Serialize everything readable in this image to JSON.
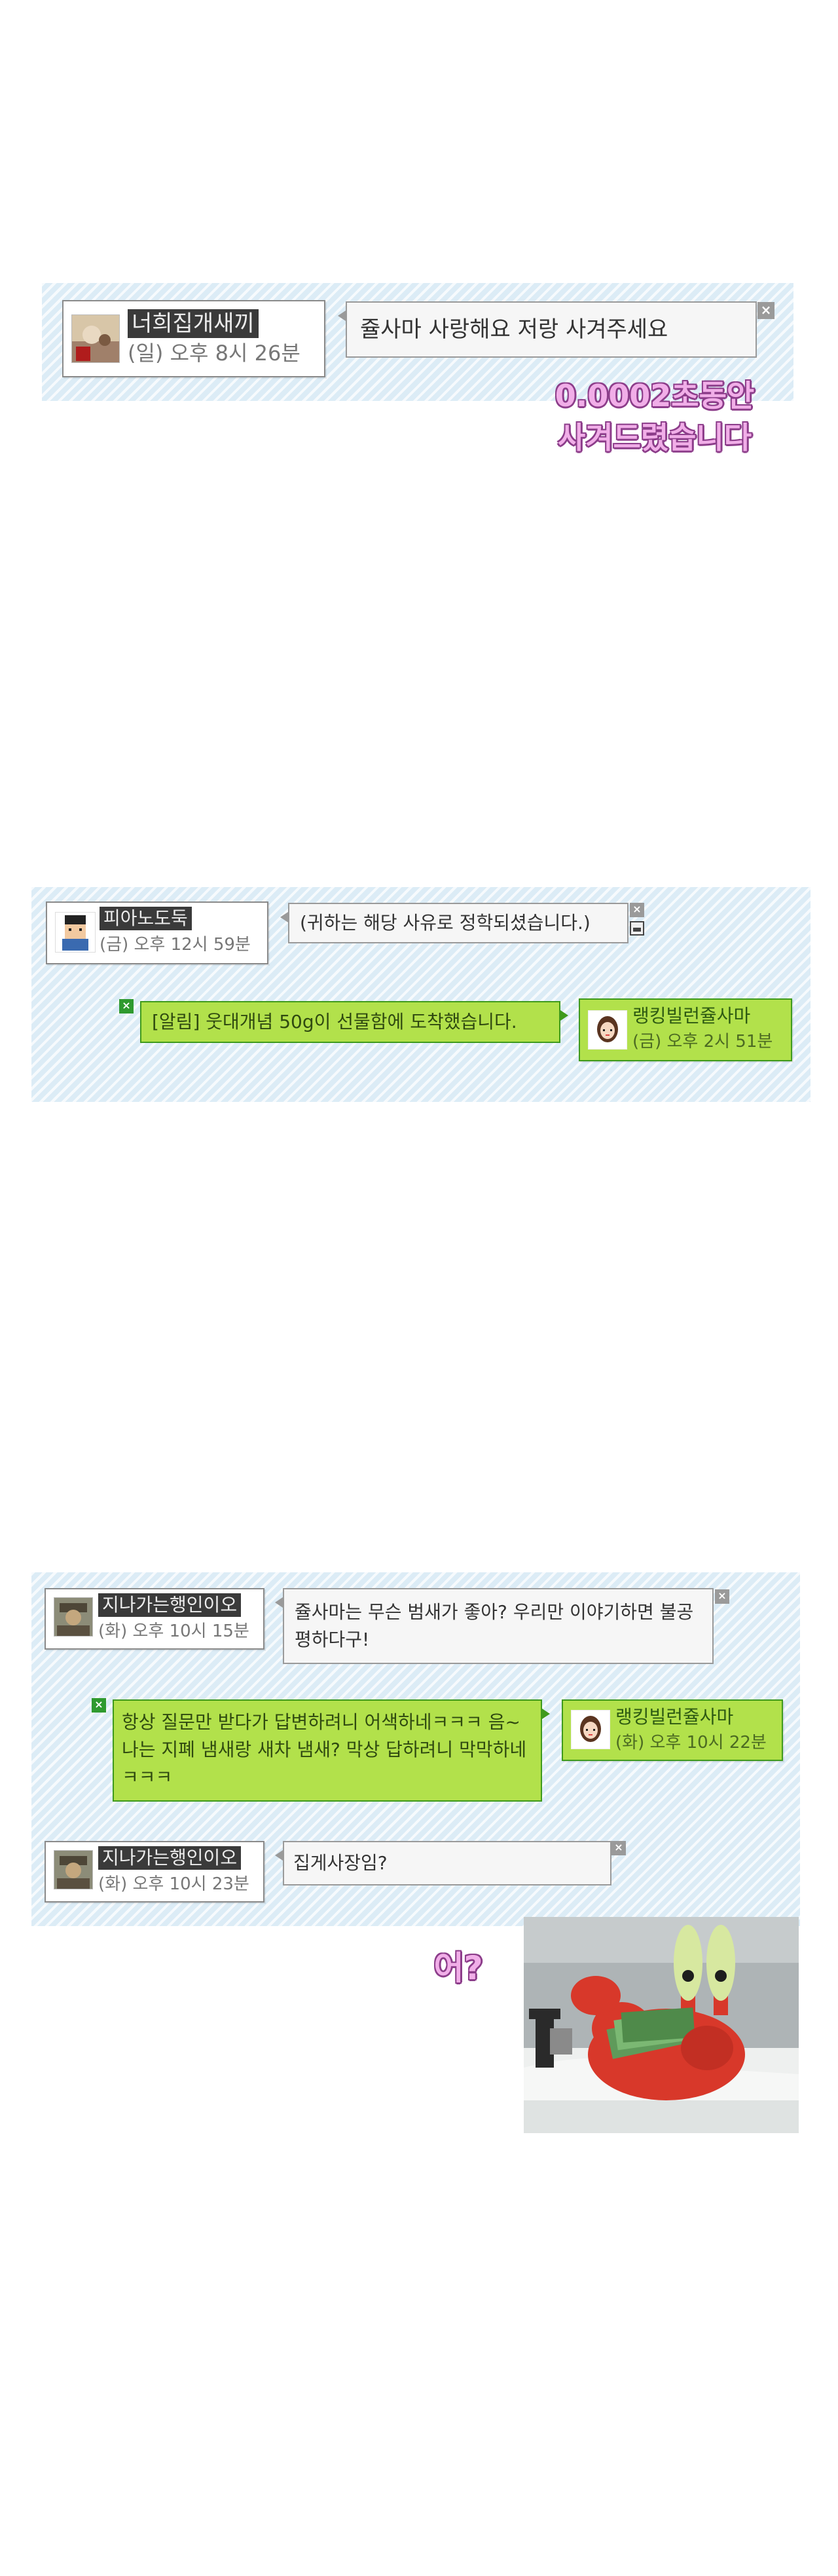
{
  "scene1": {
    "user_name": "너희집개새끼",
    "user_time": "(일) 오후 8시 26분",
    "message": "쥴사마 사랑해요 저랑 사겨주세요",
    "close_glyph": "×",
    "caption_line1": "0.0002초동안",
    "caption_line2": "사겨드렸습니다"
  },
  "scene2": {
    "user_name": "피아노도둑",
    "user_time": "(금) 오후 12시 59분",
    "message": "(귀하는 해당 사유로 정학되셨습니다.)",
    "alert_message": "[알림] 웃대개념 50g이 선물함에 도착했습니다.",
    "reply_name": "랭킹빌런쥴사마",
    "reply_time": "(금) 오후 2시 51분",
    "close_glyph": "×"
  },
  "scene3": {
    "user1_name": "지나가는행인이오",
    "user1_time": "(화) 오후 10시 15분",
    "message1": "쥴사마는 무슨 범새가 좋아? 우리만 이야기하면 불공평하다구!",
    "reply_message": "항상 질문만 받다가 답변하려니 어색하네ㅋㅋㅋ 음~ 나는 지폐 냄새랑 새차 냄새? 막상 답하려니 막막하네ㅋㅋㅋ",
    "reply_name": "랭킹빌런쥴사마",
    "reply_time": "(화) 오후 10시 22분",
    "user2_name": "지나가는행인이오",
    "user2_time": "(화) 오후 10시 23분",
    "message2": "집게사장임?",
    "caption": "어?",
    "close_glyph": "×"
  },
  "colors": {
    "panel_bg": "#dcecf6",
    "green_bubble": "#b2e14b",
    "green_border": "#3f9a1c",
    "caption_fill": "#f1aee8",
    "caption_stroke": "#8c3d8a"
  }
}
